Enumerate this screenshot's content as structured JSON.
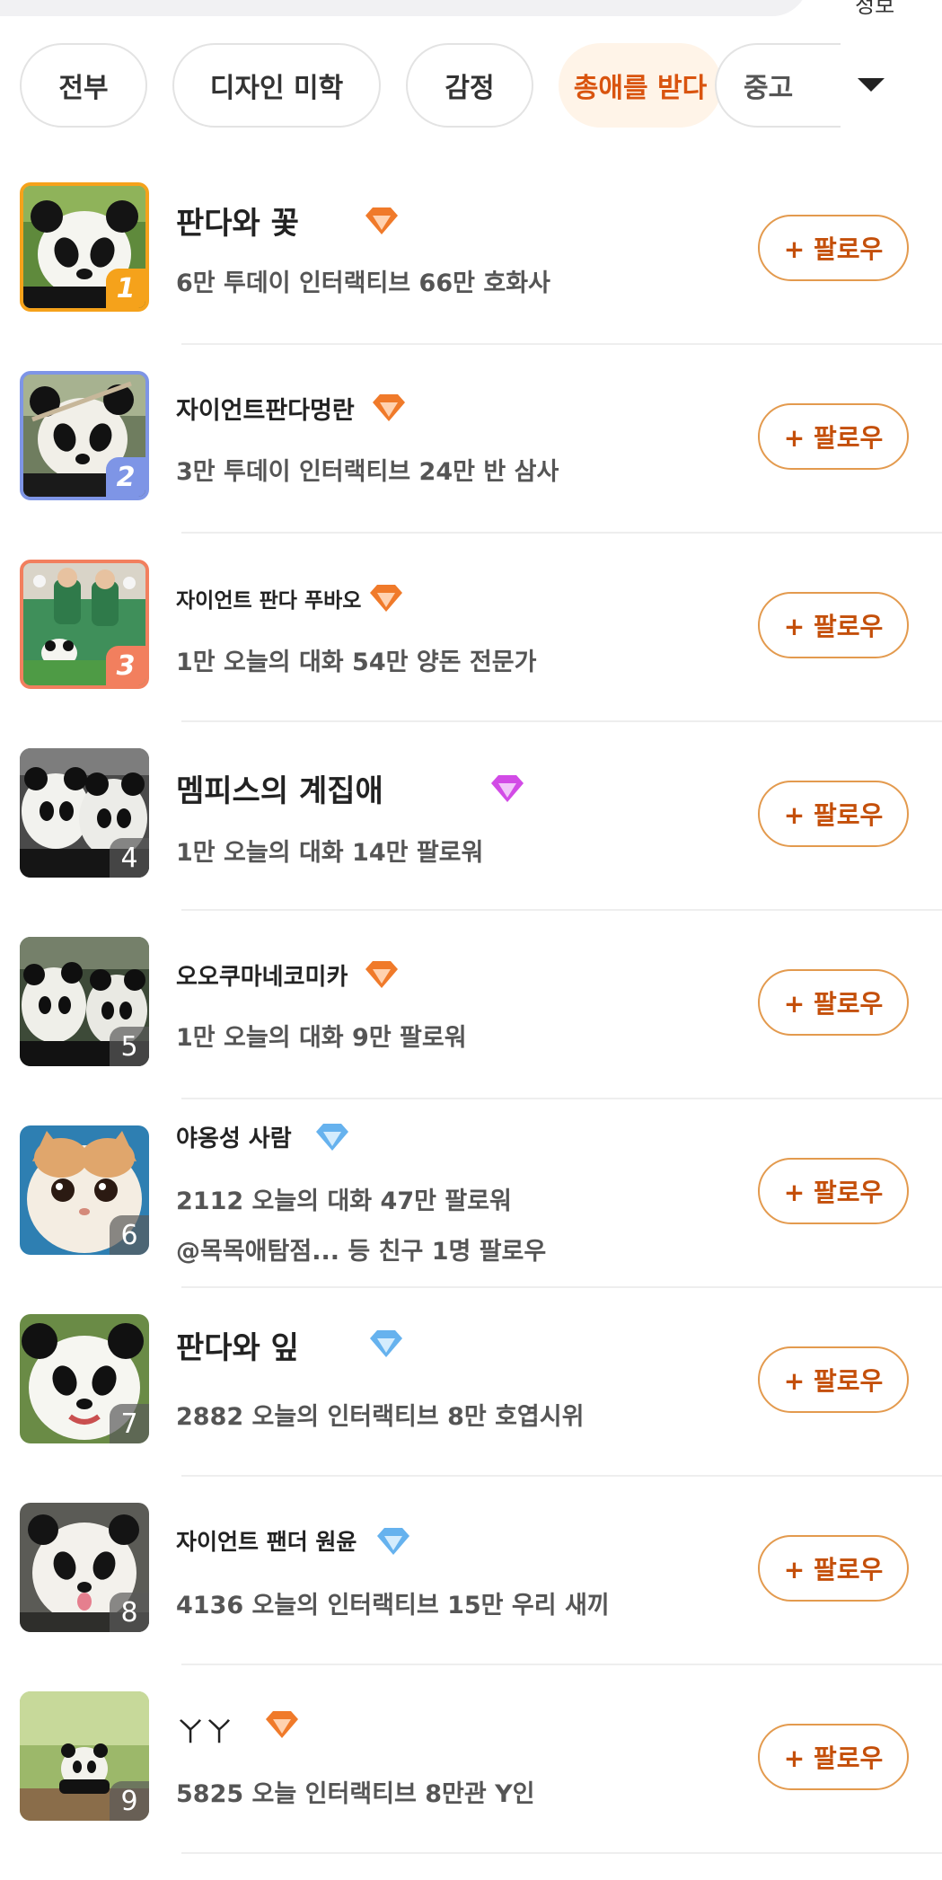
{
  "top_edge_text": "정보",
  "tabs": [
    "전부",
    "디자인 미학",
    "감정",
    "총애를 받다",
    "중고"
  ],
  "active_tab_index": 3,
  "colors": {
    "accent": "#d9540f",
    "follow_border": "#e39a4e",
    "active_tab_bg": "#fff4e8",
    "gem_orange": "#f07a2a",
    "gem_purple": "#d24be6",
    "gem_blue": "#66b2ee"
  },
  "follow_label": "+ 팔로우",
  "items": [
    {
      "rank": "1",
      "name": "판다와 꽃",
      "gem": "gem-orange-icon",
      "stats": "6만 투데이 인터랙티브 66만 호화사",
      "social": ""
    },
    {
      "rank": "2",
      "name": "자이언트판다멍란",
      "gem": "gem-orange-icon",
      "stats": "3만 투데이 인터랙티브 24만 반 삼사",
      "social": ""
    },
    {
      "rank": "3",
      "name": "자이언트 판다 푸바오",
      "gem": "gem-orange-icon",
      "stats": "1만 오늘의 대화 54만 양돈 전문가",
      "social": ""
    },
    {
      "rank": "4",
      "name": "멤피스의 계집애",
      "gem": "gem-purple-icon",
      "stats": "1만 오늘의 대화 14만 팔로워",
      "social": ""
    },
    {
      "rank": "5",
      "name": "오오쿠마네코미카",
      "gem": "gem-orange-icon",
      "stats": "1만 오늘의 대화 9만 팔로워",
      "social": ""
    },
    {
      "rank": "6",
      "name": "야옹성 사람",
      "gem": "gem-blue-icon",
      "stats": "2112 오늘의 대화 47만 팔로워",
      "social": "@목목애탐점... 등 친구 1명 팔로우"
    },
    {
      "rank": "7",
      "name": "판다와 잎",
      "gem": "gem-blue-icon",
      "stats": "2882 오늘의 인터랙티브 8만 호엽시위",
      "social": ""
    },
    {
      "rank": "8",
      "name": "자이언트 팬더 원윤",
      "gem": "gem-blue-icon",
      "stats": "4136 오늘의 인터랙티브 15만 우리 새끼",
      "social": ""
    },
    {
      "rank": "9",
      "name": "ㄚㄚ",
      "gem": "gem-orange-icon",
      "stats": "5825 오늘 인터랙티브 8만관 Y인",
      "social": ""
    }
  ]
}
